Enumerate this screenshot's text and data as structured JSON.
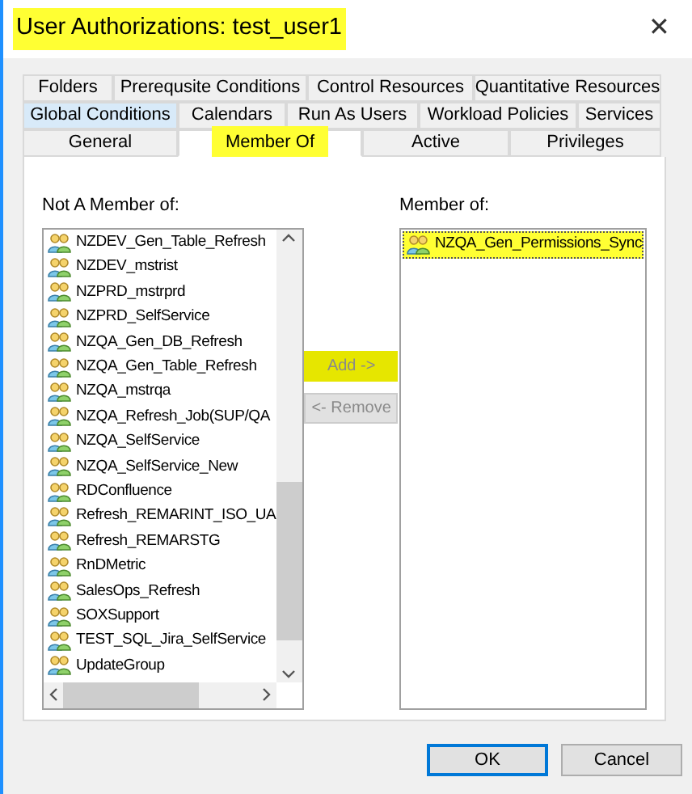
{
  "window": {
    "title": "User Authorizations: test_user1",
    "title_highlighted": true,
    "close": "✕"
  },
  "tab_rows": [
    [
      {
        "label": "Folders",
        "selected": false,
        "hovered": false,
        "highlighted": false
      },
      {
        "label": "Prerequsite Conditions",
        "selected": false,
        "hovered": false,
        "highlighted": false
      },
      {
        "label": "Control Resources",
        "selected": false,
        "hovered": false,
        "highlighted": false
      },
      {
        "label": "Quantitative Resources",
        "selected": false,
        "hovered": false,
        "highlighted": false
      }
    ],
    [
      {
        "label": "Global Conditions",
        "selected": false,
        "hovered": true,
        "highlighted": false
      },
      {
        "label": "Calendars",
        "selected": false,
        "hovered": false,
        "highlighted": false
      },
      {
        "label": "Run As Users",
        "selected": false,
        "hovered": false,
        "highlighted": false
      },
      {
        "label": "Workload Policies",
        "selected": false,
        "hovered": false,
        "highlighted": false
      },
      {
        "label": "Services",
        "selected": false,
        "hovered": false,
        "highlighted": false
      }
    ],
    [
      {
        "label": "General",
        "selected": false,
        "hovered": false,
        "highlighted": false
      },
      {
        "label": "Member Of",
        "selected": true,
        "hovered": false,
        "highlighted": true
      },
      {
        "label": "Active",
        "selected": false,
        "hovered": false,
        "highlighted": false
      },
      {
        "label": "Privileges",
        "selected": false,
        "hovered": false,
        "highlighted": false
      }
    ]
  ],
  "not_member": {
    "label": "Not A Member of:",
    "items": [
      {
        "name": "NZDEV_Gen_Table_Refresh"
      },
      {
        "name": "NZDEV_mstrist"
      },
      {
        "name": "NZPRD_mstrprd"
      },
      {
        "name": "NZPRD_SelfService"
      },
      {
        "name": "NZQA_Gen_DB_Refresh"
      },
      {
        "name": "NZQA_Gen_Table_Refresh"
      },
      {
        "name": "NZQA_mstrqa"
      },
      {
        "name": "NZQA_Refresh_Job(SUP/QA"
      },
      {
        "name": "NZQA_SelfService"
      },
      {
        "name": "NZQA_SelfService_New"
      },
      {
        "name": "RDConfluence"
      },
      {
        "name": "Refresh_REMARINT_ISO_UA"
      },
      {
        "name": "Refresh_REMARSTG"
      },
      {
        "name": "RnDMetric"
      },
      {
        "name": "SalesOps_Refresh"
      },
      {
        "name": "SOXSupport"
      },
      {
        "name": "TEST_SQL_Jira_SelfService"
      },
      {
        "name": "UpdateGroup"
      }
    ]
  },
  "move_buttons": [
    {
      "label": "Add ->",
      "disabled": true,
      "highlighted": true
    },
    {
      "label": "<- Remove",
      "disabled": true,
      "highlighted": false
    }
  ],
  "member": {
    "label": "Member of:",
    "items": [
      {
        "name": "NZQA_Gen_Permissions_Sync",
        "highlighted": true
      }
    ]
  },
  "buttons": [
    {
      "label": "OK",
      "default": true
    },
    {
      "label": "Cancel",
      "default": false
    }
  ]
}
